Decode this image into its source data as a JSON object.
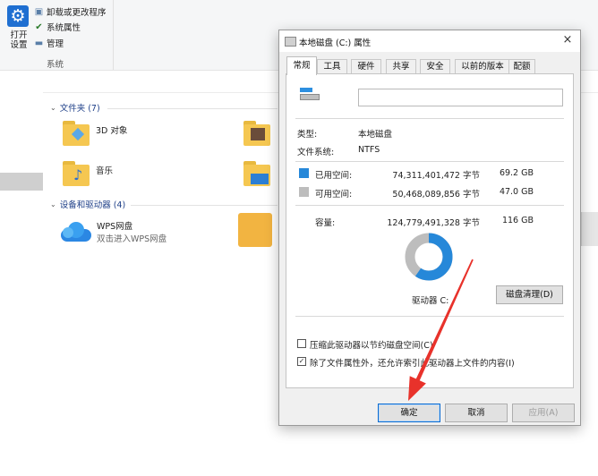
{
  "ribbon": {
    "open_settings": "打开\n设置",
    "items": [
      "卸载或更改程序",
      "系统属性",
      "管理"
    ],
    "group_label": "系统"
  },
  "explorer": {
    "folders_header": "文件夹 (7)",
    "folders": [
      "3D 对象",
      "音乐"
    ],
    "devices_header": "设备和驱动器 (4)",
    "wps": {
      "title": "WPS网盘",
      "subtitle": "双击进入WPS网盘"
    }
  },
  "dialog": {
    "title": "本地磁盘 (C:) 属性",
    "close_glyph": "×",
    "tabs": [
      "常规",
      "工具",
      "硬件",
      "共享",
      "安全",
      "以前的版本",
      "配额"
    ],
    "active_tab": "常规",
    "name_value": "",
    "type_label": "类型:",
    "type_value": "本地磁盘",
    "fs_label": "文件系统:",
    "fs_value": "NTFS",
    "used": {
      "label": "已用空间:",
      "bytes": "74,311,401,472 字节",
      "size": "69.2 GB",
      "color": "#2688d9"
    },
    "free": {
      "label": "可用空间:",
      "bytes": "50,468,089,856 字节",
      "size": "47.0 GB",
      "color": "#bdbdbd"
    },
    "capacity": {
      "label": "容量:",
      "bytes": "124,779,491,328 字节",
      "size": "116 GB"
    },
    "drive_label": "驱动器 C:",
    "cleanup_button": "磁盘清理(D)",
    "compress_label": "压缩此驱动器以节约磁盘空间(C)",
    "compress_checked": false,
    "index_label": "除了文件属性外，还允许索引此驱动器上文件的内容(I)",
    "index_checked": true,
    "ok_button": "确定",
    "cancel_button": "取消",
    "apply_button": "应用(A)"
  },
  "usage_fraction_used": 0.5955,
  "accent_color": "#0a6bd1",
  "annotation_color": "#e8322b"
}
